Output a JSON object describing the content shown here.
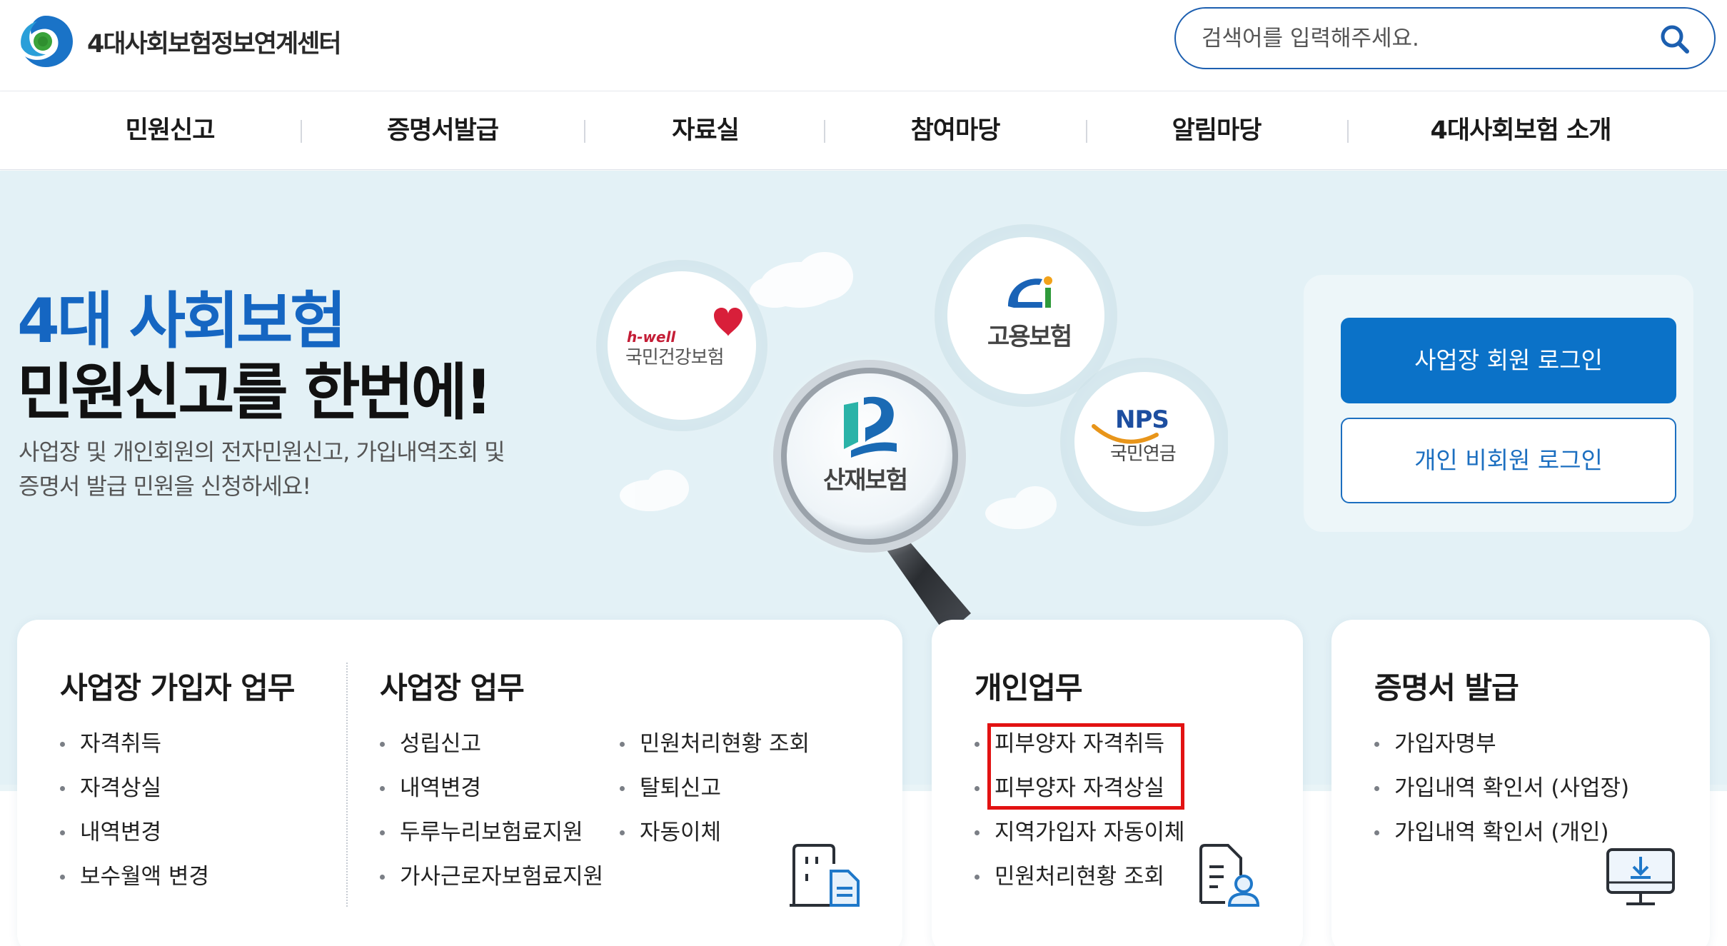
{
  "header": {
    "logo_text": "4대사회보험정보연계센터",
    "search_placeholder": "검색어를 입력해주세요."
  },
  "nav": {
    "items": [
      {
        "label": "민원신고"
      },
      {
        "label": "증명서발급"
      },
      {
        "label": "자료실"
      },
      {
        "label": "참여마당"
      },
      {
        "label": "알림마당"
      },
      {
        "label": "4대사회보험 소개"
      }
    ]
  },
  "hero": {
    "title_line1": "4대 사회보험",
    "title_line2": "민원신고를 한번에!",
    "desc_line1": "사업장 및 개인회원의 전자민원신고, 가입내역조회 및",
    "desc_line2": "증명서 발급 민원을 신청하세요!",
    "insurers": {
      "health": {
        "brand": "h-well",
        "name": "국민건강보험"
      },
      "employment": {
        "name": "고용보험"
      },
      "industrial": {
        "name": "산재보험"
      },
      "pension": {
        "brand": "NPS",
        "name": "국민연금"
      }
    },
    "colors": {
      "accent": "#1566c2",
      "button": "#0b72c8"
    }
  },
  "login": {
    "business_label": "사업장 회원 로그인",
    "personal_label": "개인 비회원 로그인"
  },
  "cards": {
    "biz_member": {
      "title": "사업장 가입자 업무",
      "items": [
        "자격취득",
        "자격상실",
        "내역변경",
        "보수월액 변경"
      ]
    },
    "biz": {
      "title": "사업장 업무",
      "col1": [
        "성립신고",
        "내역변경",
        "두루누리보험료지원",
        "가사근로자보험료지원"
      ],
      "col2": [
        "민원처리현황 조회",
        "탈퇴신고",
        "자동이체"
      ]
    },
    "personal": {
      "title": "개인업무",
      "items": [
        "피부양자 자격취득",
        "피부양자 자격상실",
        "지역가입자 자동이체",
        "민원처리현황 조회"
      ]
    },
    "certificate": {
      "title": "증명서 발급",
      "items": [
        "가입자명부",
        "가입내역 확인서 (사업장)",
        "가입내역 확인서 (개인)"
      ]
    }
  }
}
